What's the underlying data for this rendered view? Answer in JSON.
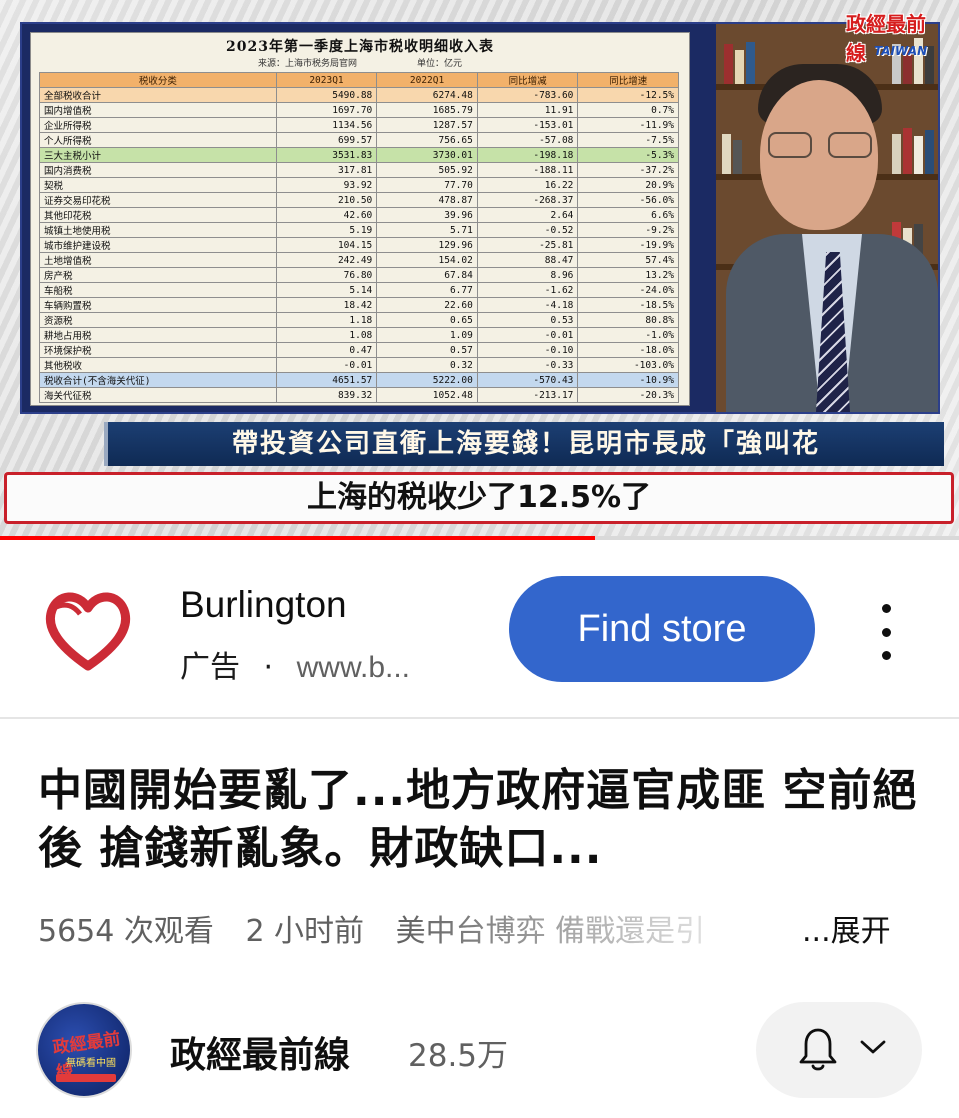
{
  "video": {
    "tax_table": {
      "title": "2023年第一季度上海市税收明细收入表",
      "source": "来源：上海市税务局官网",
      "unit": "单位：亿元",
      "headers": [
        "税收分类",
        "2023Q1",
        "2022Q1",
        "同比增减",
        "同比增速"
      ],
      "rows": [
        [
          "全部税收合计",
          "5490.88",
          "6274.48",
          "-783.60",
          "-12.5%"
        ],
        [
          "国内增值税",
          "1697.70",
          "1685.79",
          "11.91",
          "0.7%"
        ],
        [
          "企业所得税",
          "1134.56",
          "1287.57",
          "-153.01",
          "-11.9%"
        ],
        [
          "个人所得税",
          "699.57",
          "756.65",
          "-57.08",
          "-7.5%"
        ],
        [
          "三大主税小计",
          "3531.83",
          "3730.01",
          "-198.18",
          "-5.3%"
        ],
        [
          "国内消费税",
          "317.81",
          "505.92",
          "-188.11",
          "-37.2%"
        ],
        [
          "契税",
          "93.92",
          "77.70",
          "16.22",
          "20.9%"
        ],
        [
          "证券交易印花税",
          "210.50",
          "478.87",
          "-268.37",
          "-56.0%"
        ],
        [
          "其他印花税",
          "42.60",
          "39.96",
          "2.64",
          "6.6%"
        ],
        [
          "城镇土地使用税",
          "5.19",
          "5.71",
          "-0.52",
          "-9.2%"
        ],
        [
          "城市维护建设税",
          "104.15",
          "129.96",
          "-25.81",
          "-19.9%"
        ],
        [
          "土地增值税",
          "242.49",
          "154.02",
          "88.47",
          "57.4%"
        ],
        [
          "房产税",
          "76.80",
          "67.84",
          "8.96",
          "13.2%"
        ],
        [
          "车船税",
          "5.14",
          "6.77",
          "-1.62",
          "-24.0%"
        ],
        [
          "车辆购置税",
          "18.42",
          "22.60",
          "-4.18",
          "-18.5%"
        ],
        [
          "资源税",
          "1.18",
          "0.65",
          "0.53",
          "80.8%"
        ],
        [
          "耕地占用税",
          "1.08",
          "1.09",
          "-0.01",
          "-1.0%"
        ],
        [
          "环境保护税",
          "0.47",
          "0.57",
          "-0.10",
          "-18.0%"
        ],
        [
          "其他税收",
          "-0.01",
          "0.32",
          "-0.33",
          "-103.0%"
        ],
        [
          "税收合计(不含海关代征)",
          "4651.57",
          "5222.00",
          "-570.43",
          "-10.9%"
        ],
        [
          "海关代征税",
          "839.32",
          "1052.48",
          "-213.17",
          "-20.3%"
        ]
      ]
    },
    "logo_text": "政經最前線",
    "logo_sub": "TAIWAN",
    "banner_blue": "帶投資公司直衝上海要錢！昆明市長成「強叫花",
    "banner_white": "上海的税收少了12.5%了",
    "progress_fraction": 0.62
  },
  "ad": {
    "advertiser": "Burlington",
    "label": "广告",
    "separator": "·",
    "url": "www.b...",
    "button": "Find store",
    "brand_color": "#cc2b36"
  },
  "title": "中國開始要亂了...地方政府逼官成匪 空前絕後 搶錢新亂象。財政缺口...",
  "meta": {
    "views": "5654 次观看",
    "time": "2 小时前",
    "tags": "美中台博弈 備戰還是引",
    "expand": "...展开"
  },
  "channel": {
    "name": "政經最前線",
    "subscribers": "28.5万",
    "avatar_text": "政經最前線",
    "avatar_sub": "無碼看中國"
  },
  "colors": {
    "accent_button": "#3366cc",
    "progress": "#ff0000"
  }
}
